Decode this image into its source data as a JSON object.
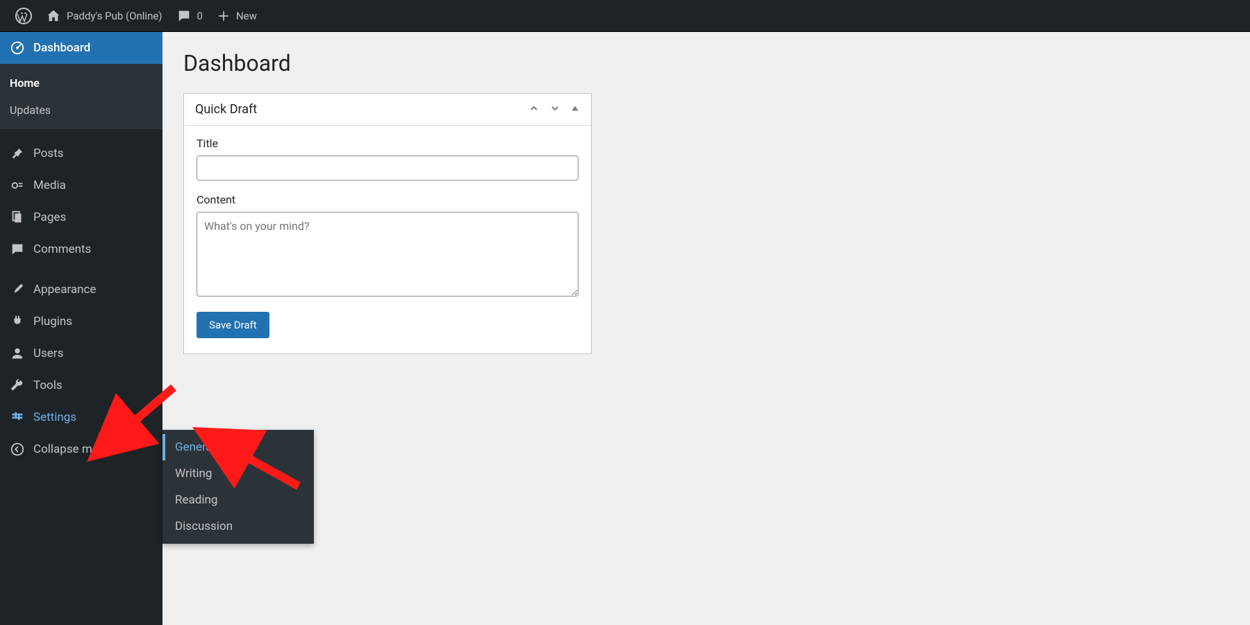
{
  "admin_bar": {
    "site_name": "Paddy's Pub (Online)",
    "comments_count": "0",
    "new_label": "New"
  },
  "sidebar": {
    "dashboard_label": "Dashboard",
    "dashboard_submenu": {
      "home": "Home",
      "updates": "Updates"
    },
    "posts": "Posts",
    "media": "Media",
    "pages": "Pages",
    "comments": "Comments",
    "appearance": "Appearance",
    "plugins": "Plugins",
    "users": "Users",
    "tools": "Tools",
    "settings": "Settings",
    "collapse": "Collapse menu"
  },
  "settings_flyout": {
    "general": "General",
    "writing": "Writing",
    "reading": "Reading",
    "discussion": "Discussion"
  },
  "page": {
    "title": "Dashboard"
  },
  "quick_draft": {
    "widget_title": "Quick Draft",
    "title_label": "Title",
    "content_label": "Content",
    "content_placeholder": "What's on your mind?",
    "save_label": "Save Draft"
  }
}
